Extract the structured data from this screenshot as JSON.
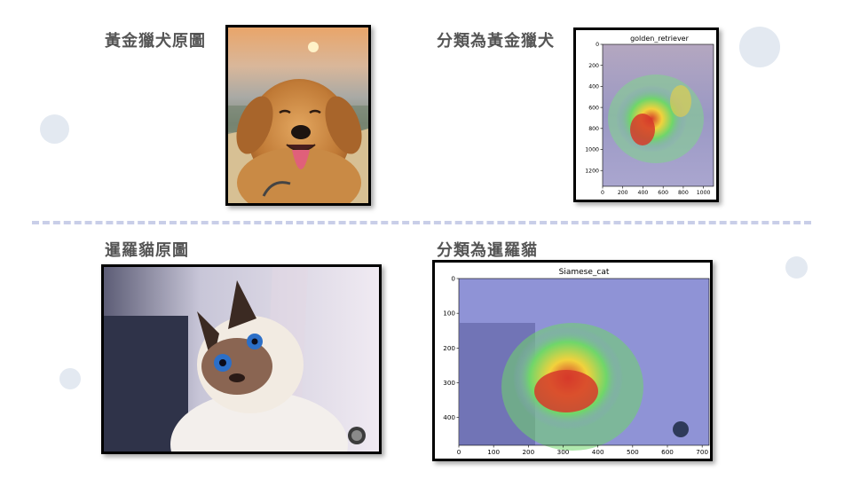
{
  "slide": {
    "golden_original_label": "黃金獵犬原圖",
    "golden_classified_label": "分類為黃金獵犬",
    "siamese_original_label": "暹羅貓原圖",
    "siamese_classified_label": "分類為暹羅貓"
  },
  "colors": {
    "deco_circle": "#e3e9f1",
    "divider": "#c9cee8",
    "label_text": "#555555",
    "heat_hot": "#d63a2a",
    "heat_warm": "#f2d23c",
    "heat_mid": "#6fd66a",
    "heat_cool": "#8f93d6"
  },
  "images": {
    "golden_photo": "golden retriever smiling with tongue out, sunset background",
    "siamese_photo": "siamese cat with blue eyes looking up"
  },
  "chart_data": [
    {
      "type": "heatmap",
      "title": "golden_retriever",
      "xlabel": "",
      "ylabel": "",
      "xlim": [
        0,
        1100
      ],
      "ylim": [
        1350,
        0
      ],
      "x_ticks": [
        "0",
        "200",
        "400",
        "600",
        "800",
        "1000"
      ],
      "y_ticks": [
        "0",
        "200",
        "400",
        "600",
        "800",
        "1000",
        "1200"
      ],
      "grid": false
    },
    {
      "type": "heatmap",
      "title": "Siamese_cat",
      "xlabel": "",
      "ylabel": "",
      "xlim": [
        0,
        720
      ],
      "ylim": [
        480,
        0
      ],
      "x_ticks": [
        "0",
        "100",
        "200",
        "300",
        "400",
        "500",
        "600",
        "700"
      ],
      "y_ticks": [
        "0",
        "100",
        "200",
        "300",
        "400"
      ],
      "grid": false
    }
  ]
}
